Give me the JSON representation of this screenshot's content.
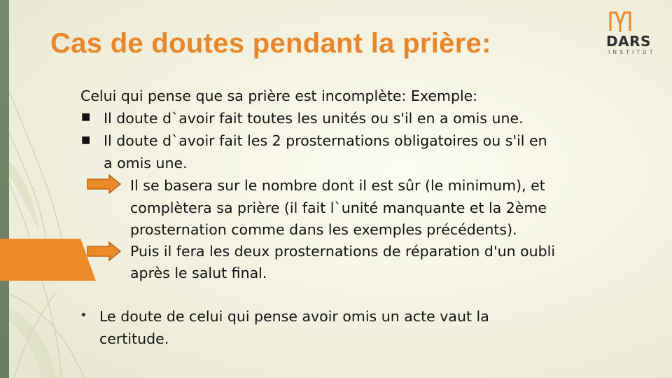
{
  "slide": {
    "title": "Cas de doutes pendant la prière:",
    "logo": {
      "name": "DARS",
      "sub": "INSTITUT",
      "colors": {
        "mark": "#e8862b",
        "text": "#2f2f2f"
      }
    },
    "intro": "Celui qui pense que sa prière est incomplète: Exemple:",
    "bullets": [
      {
        "line1": "Il doute d`avoir fait toutes les unités ou s'il en a omis une."
      },
      {
        "line1": "Il doute d`avoir fait les 2 prosternations obligatoires ou s'il en",
        "line2": "a omis une."
      }
    ],
    "arrows": [
      {
        "lines": [
          "Il se basera sur le nombre dont il est sûr (le minimum), et",
          "complètera sa prière (il fait l`unité manquante et la 2ème",
          "prosternation comme dans les exemples précédents)."
        ]
      },
      {
        "lines": [
          "Puis il fera les deux prosternations de réparation d'un oubli",
          "après le salut final."
        ]
      }
    ],
    "final_bullet": {
      "line1": "Le doute de celui qui pense avoir omis un acte vaut la",
      "line2": "certitude."
    },
    "colors": {
      "accent": "#e8862b",
      "left_bar": "#6f8163",
      "background": "#f6f5e6"
    },
    "icons": {
      "bullet_square": "square-bullet-icon",
      "arrow": "right-arrow-icon",
      "dot": "round-bullet-icon"
    }
  }
}
